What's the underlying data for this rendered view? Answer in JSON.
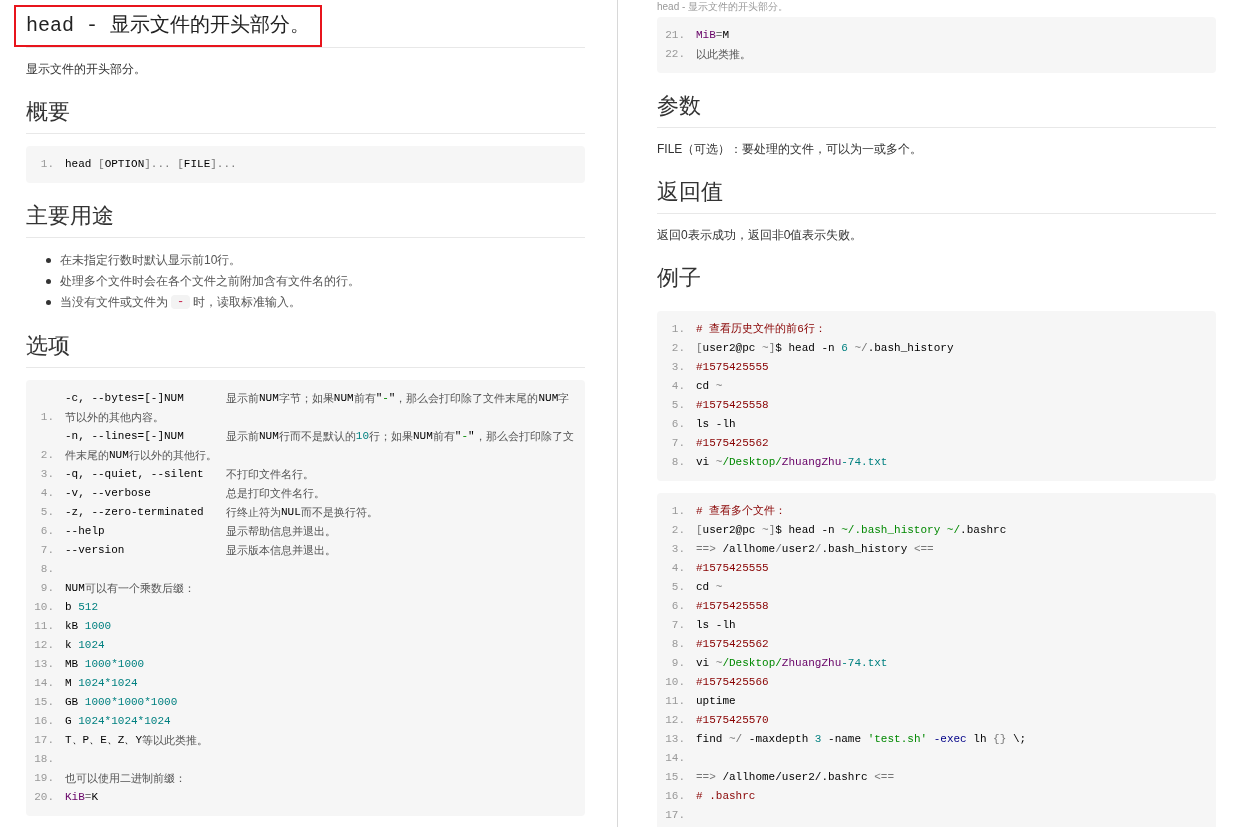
{
  "columns": [
    {
      "blocks": [
        {
          "kind": "title",
          "text": "head - 显示文件的开头部分。",
          "highlighted": true
        },
        {
          "kind": "text",
          "text": "显示文件的开头部分。"
        },
        {
          "kind": "heading",
          "text": "概要",
          "rule": true
        },
        {
          "kind": "code",
          "lines": [
            {
              "n": "1.",
              "seg": [
                {
                  "t": "head ",
                  "kind": "p"
                },
                {
                  "t": "[",
                  "kind": "g"
                },
                {
                  "t": "OPTION",
                  "kind": "p"
                },
                {
                  "t": "]... [",
                  "kind": "g"
                },
                {
                  "t": "FILE",
                  "kind": "p"
                },
                {
                  "t": "]...",
                  "kind": "g"
                }
              ]
            }
          ]
        },
        {
          "kind": "heading",
          "text": "主要用途",
          "rule": true
        },
        {
          "kind": "list",
          "items": [
            {
              "seg": [
                {
                  "t": "在未指定行数时默认显示前10行。",
                  "kind": "t"
                }
              ]
            },
            {
              "seg": [
                {
                  "t": "处理多个文件时会在各个文件之前附加含有文件名的行。",
                  "kind": "t"
                }
              ]
            },
            {
              "seg": [
                {
                  "t": "当没有文件或文件为",
                  "kind": "t"
                },
                {
                  "t": "-",
                  "kind": "code"
                },
                {
                  "t": "时，读取标准输入。",
                  "kind": "t"
                }
              ]
            }
          ]
        },
        {
          "kind": "heading",
          "text": "选项",
          "rule": true
        },
        {
          "kind": "code",
          "lines": [
            {
              "n": "1.",
              "seg": [
                {
                  "t": "-c, --bytes=[-]NUM",
                  "kind": "o"
                },
                {
                  "t": "显示前",
                  "kind": "t"
                },
                {
                  "t": "NUM",
                  "kind": "p"
                },
                {
                  "t": "字节；如果",
                  "kind": "t"
                },
                {
                  "t": "NUM",
                  "kind": "p"
                },
                {
                  "t": "前有",
                  "kind": "t"
                },
                {
                  "t": "\"",
                  "kind": "p"
                },
                {
                  "t": "-",
                  "kind": "s"
                },
                {
                  "t": "\"",
                  "kind": "p"
                },
                {
                  "t": "，那么会打印除了文件末尾的",
                  "kind": "t"
                },
                {
                  "t": "NUM",
                  "kind": "p"
                },
                {
                  "t": "字节以外的其他内容。",
                  "kind": "t"
                }
              ]
            },
            {
              "n": "2.",
              "seg": [
                {
                  "t": "-n, --lines=[-]NUM",
                  "kind": "o"
                },
                {
                  "t": "显示前",
                  "kind": "t"
                },
                {
                  "t": "NUM",
                  "kind": "p"
                },
                {
                  "t": "行而不是默认的",
                  "kind": "t"
                },
                {
                  "t": "10",
                  "kind": "n"
                },
                {
                  "t": "行；如果",
                  "kind": "t"
                },
                {
                  "t": "NUM",
                  "kind": "p"
                },
                {
                  "t": "前有",
                  "kind": "t"
                },
                {
                  "t": "\"",
                  "kind": "p"
                },
                {
                  "t": "-",
                  "kind": "s"
                },
                {
                  "t": "\"",
                  "kind": "p"
                },
                {
                  "t": "，那么会打印除了文件末尾的",
                  "kind": "t"
                },
                {
                  "t": "NUM",
                  "kind": "p"
                },
                {
                  "t": "行以外的其他行。",
                  "kind": "t"
                }
              ]
            },
            {
              "n": "3.",
              "seg": [
                {
                  "t": "-q, --quiet, --silent",
                  "kind": "o"
                },
                {
                  "t": "不打印文件名行。",
                  "kind": "t"
                }
              ]
            },
            {
              "n": "4.",
              "seg": [
                {
                  "t": "-v, --verbose",
                  "kind": "o"
                },
                {
                  "t": "总是打印文件名行。",
                  "kind": "t"
                }
              ]
            },
            {
              "n": "5.",
              "seg": [
                {
                  "t": "-z, --zero-terminated",
                  "kind": "o"
                },
                {
                  "t": "行终止符为",
                  "kind": "t"
                },
                {
                  "t": "NUL",
                  "kind": "p"
                },
                {
                  "t": "而不是换行符。",
                  "kind": "t"
                }
              ]
            },
            {
              "n": "6.",
              "seg": [
                {
                  "t": "--help",
                  "kind": "o"
                },
                {
                  "t": "显示帮助信息并退出。",
                  "kind": "t"
                }
              ]
            },
            {
              "n": "7.",
              "seg": [
                {
                  "t": "--version",
                  "kind": "o"
                },
                {
                  "t": "显示版本信息并退出。",
                  "kind": "t"
                }
              ]
            },
            {
              "n": "8."
            },
            {
              "n": "9.",
              "seg": [
                {
                  "t": "NUM",
                  "kind": "p"
                },
                {
                  "t": "可以有一个乘数后缀：",
                  "kind": "t"
                }
              ]
            },
            {
              "n": "10.",
              "seg": [
                {
                  "t": "b ",
                  "kind": "p"
                },
                {
                  "t": "512",
                  "kind": "n"
                }
              ]
            },
            {
              "n": "11.",
              "seg": [
                {
                  "t": "kB ",
                  "kind": "p"
                },
                {
                  "t": "1000",
                  "kind": "n"
                }
              ]
            },
            {
              "n": "12.",
              "seg": [
                {
                  "t": "k ",
                  "kind": "p"
                },
                {
                  "t": "1024",
                  "kind": "n"
                }
              ]
            },
            {
              "n": "13.",
              "seg": [
                {
                  "t": "MB ",
                  "kind": "p"
                },
                {
                  "t": "1000*1000",
                  "kind": "n"
                }
              ]
            },
            {
              "n": "14.",
              "seg": [
                {
                  "t": "M ",
                  "kind": "p"
                },
                {
                  "t": "1024*1024",
                  "kind": "n"
                }
              ]
            },
            {
              "n": "15.",
              "seg": [
                {
                  "t": "GB ",
                  "kind": "p"
                },
                {
                  "t": "1000*1000*1000",
                  "kind": "n"
                }
              ]
            },
            {
              "n": "16.",
              "seg": [
                {
                  "t": "G ",
                  "kind": "p"
                },
                {
                  "t": "1024*1024*1024",
                  "kind": "n"
                }
              ]
            },
            {
              "n": "17.",
              "seg": [
                {
                  "t": "T、P、E、Z、Y",
                  "kind": "p"
                },
                {
                  "t": "等以此类推。",
                  "kind": "t"
                }
              ]
            },
            {
              "n": "18."
            },
            {
              "n": "19.",
              "seg": [
                {
                  "t": "也可以使用二进制前缀：",
                  "kind": "t"
                }
              ]
            },
            {
              "n": "20.",
              "seg": [
                {
                  "t": "KiB",
                  "kind": "v"
                },
                {
                  "t": "=",
                  "kind": "g"
                },
                {
                  "t": "K",
                  "kind": "p"
                }
              ]
            }
          ]
        }
      ]
    },
    {
      "blocks": [
        {
          "kind": "caption",
          "text": "head - 显示文件的开头部分。"
        },
        {
          "kind": "code",
          "lines": [
            {
              "n": "21.",
              "seg": [
                {
                  "t": "MiB",
                  "kind": "v"
                },
                {
                  "t": "=",
                  "kind": "g"
                },
                {
                  "t": "M",
                  "kind": "p"
                }
              ]
            },
            {
              "n": "22.",
              "seg": [
                {
                  "t": "以此类推。",
                  "kind": "t"
                }
              ]
            }
          ]
        },
        {
          "kind": "heading",
          "text": "参数",
          "rule": true
        },
        {
          "kind": "text",
          "text": "FILE（可选）：要处理的文件，可以为一或多个。"
        },
        {
          "kind": "heading",
          "text": "返回值",
          "rule": true
        },
        {
          "kind": "text",
          "text": "返回0表示成功，返回非0值表示失败。"
        },
        {
          "kind": "heading",
          "text": "例子",
          "rule": false
        },
        {
          "kind": "code",
          "lines": [
            {
              "n": "1.",
              "seg": [
                {
                  "t": "# 查看历史文件的前6行：",
                  "kind": "c"
                }
              ]
            },
            {
              "n": "2.",
              "seg": [
                {
                  "t": "[",
                  "kind": "g"
                },
                {
                  "t": "user2@pc ",
                  "kind": "p"
                },
                {
                  "t": "~]",
                  "kind": "g"
                },
                {
                  "t": "$ head -n ",
                  "kind": "p"
                },
                {
                  "t": "6",
                  "kind": "n"
                },
                {
                  "t": " ~/",
                  "kind": "g"
                },
                {
                  "t": ".bash_history",
                  "kind": "p"
                }
              ]
            },
            {
              "n": "3.",
              "seg": [
                {
                  "t": "#1575425555",
                  "kind": "c"
                }
              ]
            },
            {
              "n": "4.",
              "seg": [
                {
                  "t": "cd ",
                  "kind": "p"
                },
                {
                  "t": "~",
                  "kind": "g"
                }
              ]
            },
            {
              "n": "5.",
              "seg": [
                {
                  "t": "#1575425558",
                  "kind": "c"
                }
              ]
            },
            {
              "n": "6.",
              "seg": [
                {
                  "t": "ls -lh",
                  "kind": "p"
                }
              ]
            },
            {
              "n": "7.",
              "seg": [
                {
                  "t": "#1575425562",
                  "kind": "c"
                }
              ]
            },
            {
              "n": "8.",
              "seg": [
                {
                  "t": "vi ",
                  "kind": "p"
                },
                {
                  "t": "~",
                  "kind": "g"
                },
                {
                  "t": "/Desktop/",
                  "kind": "s"
                },
                {
                  "t": "ZhuangZhu",
                  "kind": "v"
                },
                {
                  "t": "-74.txt",
                  "kind": "n"
                }
              ]
            }
          ]
        },
        {
          "kind": "code",
          "lines": [
            {
              "n": "1.",
              "seg": [
                {
                  "t": "# 查看多个文件：",
                  "kind": "c"
                }
              ]
            },
            {
              "n": "2.",
              "seg": [
                {
                  "t": "[",
                  "kind": "g"
                },
                {
                  "t": "user2@pc ",
                  "kind": "p"
                },
                {
                  "t": "~]",
                  "kind": "g"
                },
                {
                  "t": "$ head -n ",
                  "kind": "p"
                },
                {
                  "t": "~/.bash_history ~/",
                  "kind": "s"
                },
                {
                  "t": ".bashrc",
                  "kind": "p"
                }
              ]
            },
            {
              "n": "3.",
              "seg": [
                {
                  "t": "==> ",
                  "kind": "g"
                },
                {
                  "t": "/allhome",
                  "kind": "p"
                },
                {
                  "t": "/",
                  "kind": "g"
                },
                {
                  "t": "user2",
                  "kind": "p"
                },
                {
                  "t": "/",
                  "kind": "g"
                },
                {
                  "t": ".bash_history ",
                  "kind": "p"
                },
                {
                  "t": "<==",
                  "kind": "g"
                }
              ]
            },
            {
              "n": "4.",
              "seg": [
                {
                  "t": "#1575425555",
                  "kind": "c"
                }
              ]
            },
            {
              "n": "5.",
              "seg": [
                {
                  "t": "cd ",
                  "kind": "p"
                },
                {
                  "t": "~",
                  "kind": "g"
                }
              ]
            },
            {
              "n": "6.",
              "seg": [
                {
                  "t": "#1575425558",
                  "kind": "c"
                }
              ]
            },
            {
              "n": "7.",
              "seg": [
                {
                  "t": "ls -lh",
                  "kind": "p"
                }
              ]
            },
            {
              "n": "8.",
              "seg": [
                {
                  "t": "#1575425562",
                  "kind": "c"
                }
              ]
            },
            {
              "n": "9.",
              "seg": [
                {
                  "t": "vi ",
                  "kind": "p"
                },
                {
                  "t": "~",
                  "kind": "g"
                },
                {
                  "t": "/Desktop/",
                  "kind": "s"
                },
                {
                  "t": "ZhuangZhu",
                  "kind": "v"
                },
                {
                  "t": "-74.txt",
                  "kind": "n"
                }
              ]
            },
            {
              "n": "10.",
              "seg": [
                {
                  "t": "#1575425566",
                  "kind": "c"
                }
              ]
            },
            {
              "n": "11.",
              "seg": [
                {
                  "t": "uptime",
                  "kind": "p"
                }
              ]
            },
            {
              "n": "12.",
              "seg": [
                {
                  "t": "#1575425570",
                  "kind": "c"
                }
              ]
            },
            {
              "n": "13.",
              "seg": [
                {
                  "t": "find ",
                  "kind": "p"
                },
                {
                  "t": "~/",
                  "kind": "g"
                },
                {
                  "t": " -maxdepth ",
                  "kind": "p"
                },
                {
                  "t": "3",
                  "kind": "n"
                },
                {
                  "t": " -name ",
                  "kind": "p"
                },
                {
                  "t": "'test.sh'",
                  "kind": "s"
                },
                {
                  "t": " -exec",
                  "kind": "k"
                },
                {
                  "t": " lh ",
                  "kind": "p"
                },
                {
                  "t": "{}",
                  "kind": "g"
                },
                {
                  "t": " \\;",
                  "kind": "p"
                }
              ]
            },
            {
              "n": "14."
            },
            {
              "n": "15.",
              "seg": [
                {
                  "t": "==> ",
                  "kind": "g"
                },
                {
                  "t": "/allhome/user2/.bashrc ",
                  "kind": "p"
                },
                {
                  "t": "<==",
                  "kind": "g"
                }
              ]
            },
            {
              "n": "16.",
              "seg": [
                {
                  "t": "# .bashrc",
                  "kind": "c"
                }
              ]
            },
            {
              "n": "17."
            }
          ]
        }
      ]
    }
  ]
}
